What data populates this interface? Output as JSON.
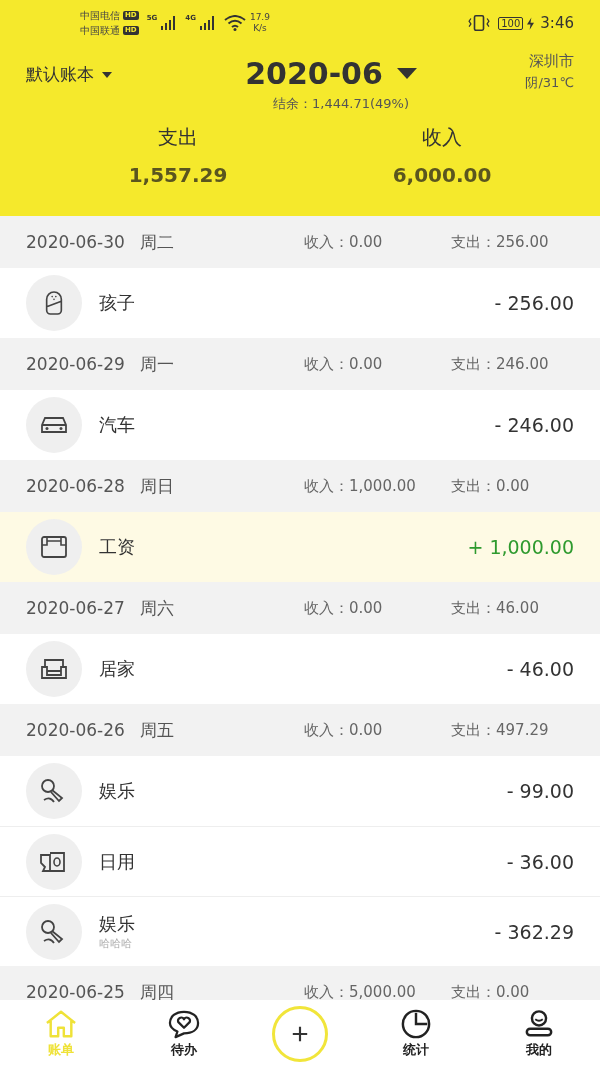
{
  "status_bar": {
    "carriers": [
      {
        "name": "中国电信",
        "badge": "HD"
      },
      {
        "name": "中国联通",
        "badge": "HD"
      }
    ],
    "networks": [
      "5G",
      "4G"
    ],
    "speed": "17.9",
    "speed_unit": "K/s",
    "battery": "100",
    "time": "3:46"
  },
  "header": {
    "book": "默认账本",
    "month": "2020-06",
    "balance": "结余：1,444.71(49%)",
    "city": "深圳市",
    "weather": "阴/31℃",
    "totals": [
      {
        "label": "支出",
        "value": "1,557.29"
      },
      {
        "label": "收入",
        "value": "6,000.00"
      }
    ]
  },
  "days": [
    {
      "date": "2020-06-30",
      "weekday": "周二",
      "income": "收入：0.00",
      "expense": "支出：256.00",
      "entries": [
        {
          "category": "孩子",
          "amount": "- 256.00",
          "kind": "expense"
        }
      ]
    },
    {
      "date": "2020-06-29",
      "weekday": "周一",
      "income": "收入：0.00",
      "expense": "支出：246.00",
      "entries": [
        {
          "category": "汽车",
          "amount": "- 246.00",
          "kind": "expense"
        }
      ]
    },
    {
      "date": "2020-06-28",
      "weekday": "周日",
      "income": "收入：1,000.00",
      "expense": "支出：0.00",
      "entries": [
        {
          "category": "工资",
          "amount": "+ 1,000.00",
          "kind": "income"
        }
      ]
    },
    {
      "date": "2020-06-27",
      "weekday": "周六",
      "income": "收入：0.00",
      "expense": "支出：46.00",
      "entries": [
        {
          "category": "居家",
          "amount": "- 46.00",
          "kind": "expense"
        }
      ]
    },
    {
      "date": "2020-06-26",
      "weekday": "周五",
      "income": "收入：0.00",
      "expense": "支出：497.29",
      "entries": [
        {
          "category": "娱乐",
          "amount": "- 99.00",
          "kind": "expense"
        },
        {
          "category": "日用",
          "amount": "- 36.00",
          "kind": "expense"
        },
        {
          "category": "娱乐",
          "note": "哈哈哈",
          "amount": "- 362.29",
          "kind": "expense"
        }
      ]
    },
    {
      "date": "2020-06-25",
      "weekday": "周四",
      "income": "收入：5,000.00",
      "expense": "支出：0.00"
    }
  ],
  "tabs": [
    {
      "kind": "tab",
      "label": "账单",
      "selected": true
    },
    {
      "kind": "tab",
      "label": "待办",
      "selected": false
    },
    {
      "kind": "add",
      "selected": false
    },
    {
      "kind": "tab",
      "label": "统计",
      "selected": false
    },
    {
      "kind": "tab",
      "label": "我的",
      "selected": false
    }
  ]
}
